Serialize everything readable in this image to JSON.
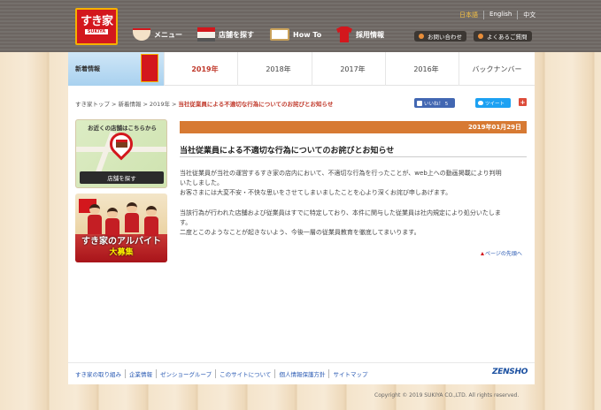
{
  "header": {
    "logo_text": "すき家",
    "logo_sub": "SUKIYA",
    "nav": [
      {
        "label": "メニュー",
        "icon": "bowl-icon"
      },
      {
        "label": "店舗を探す",
        "icon": "store-icon"
      },
      {
        "label": "How To",
        "icon": "book-icon"
      },
      {
        "label": "採用情報",
        "icon": "shirt-icon"
      }
    ],
    "languages": [
      "日本語",
      "English",
      "中文"
    ],
    "contact_label": "お問い合わせ",
    "faq_label": "よくあるご質問"
  },
  "subnav": {
    "section_label": "新着情報",
    "years": [
      "2019年",
      "2018年",
      "2017年",
      "2016年",
      "バックナンバー"
    ],
    "active_index": 0
  },
  "breadcrumb": {
    "items": [
      "すき家トップ",
      "新着情報",
      "2019年"
    ],
    "current": "当社従業員による不適切な行為についてのお詫びとお知らせ",
    "separator": ">"
  },
  "social": {
    "like_label": "いいね！ 5",
    "tweet_label": "ツイート",
    "plus_label": "+"
  },
  "sidebar": {
    "store_title": "お近くの店舗はこちらから",
    "store_button": "店舗を探す",
    "recruit_line1": "すき家のアルバイト",
    "recruit_line2": "大募集"
  },
  "article": {
    "date": "2019年01月29日",
    "title": "当社従業員による不適切な行為についてのお詫びとお知らせ",
    "paragraphs": [
      "当社従業員が当社の運営するすき家の店内において、不適切な行為を行ったことが、web上への動画掲載により判明",
      "いたしました。",
      "お客さまには大変不安・不快な思いをさせてしまいましたことを心より深くお詫び申しあげます。",
      "",
      "当該行為が行われた店舗および従業員はすでに特定しており、本件に関与した従業員は社内規定により処分いたしま",
      "す。",
      "二度とこのようなことが起きないよう、今後一層の従業員教育を徹底してまいります。"
    ],
    "to_top": "ページの先頭へ"
  },
  "footer": {
    "links": [
      "すき家の取り組み",
      "企業情報",
      "ゼンショーグループ",
      "このサイトについて",
      "個人情報保護方針",
      "サイトマップ"
    ],
    "brand": "ZENSHO",
    "copyright": "Copyright © 2019 SUKIYA CO.,LTD. All rights reserved."
  }
}
